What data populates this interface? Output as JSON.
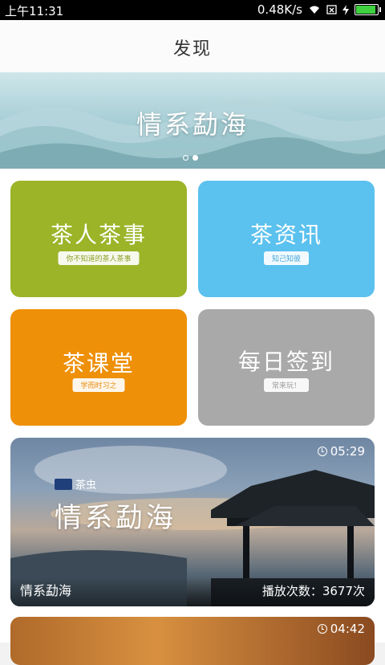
{
  "status_bar": {
    "time": "上午11:31",
    "speed": "0.48K/s"
  },
  "header": {
    "title": "发现"
  },
  "banner": {
    "text": "情系勐海"
  },
  "cards": [
    {
      "title": "茶人茶事",
      "subtitle": "你不知道的茶人茶事",
      "color": "#9bb428"
    },
    {
      "title": "茶资讯",
      "subtitle": "知己知彼",
      "color": "#5bc1ee"
    },
    {
      "title": "茶课堂",
      "subtitle": "学而时习之",
      "color": "#ee9008"
    },
    {
      "title": "每日签到",
      "subtitle": "常来玩！",
      "color": "#a9a9a9"
    }
  ],
  "videos": [
    {
      "duration": "05:29",
      "brand": "茶虫",
      "overlay_title": "情系勐海",
      "name": "情系勐海",
      "plays": "播放次数：3677次"
    },
    {
      "duration": "04:42"
    }
  ]
}
